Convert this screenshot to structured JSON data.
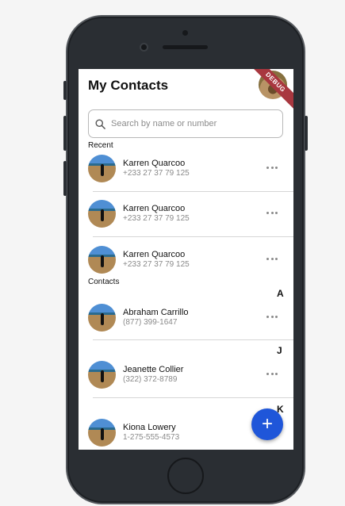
{
  "header": {
    "title": "My Contacts",
    "debug_banner": "DEBUG"
  },
  "search": {
    "placeholder": "Search by name or number",
    "value": ""
  },
  "sections": {
    "recent": "Recent",
    "contacts": "Contacts"
  },
  "recent": [
    {
      "name": "Karren Quarcoo",
      "phone": "+233 27 37 79 125"
    },
    {
      "name": "Karren Quarcoo",
      "phone": "+233 27 37 79 125"
    },
    {
      "name": "Karren Quarcoo",
      "phone": "+233 27 37 79 125"
    }
  ],
  "letters": {
    "a": "A",
    "j": "J",
    "k": "K"
  },
  "contacts": [
    {
      "name": "Abraham Carrillo",
      "phone": "(877) 399-1647"
    },
    {
      "name": "Jeanette Collier",
      "phone": "(322) 372-8789"
    },
    {
      "name": "Kiona Lowery",
      "phone": "1-275-555-4573"
    }
  ],
  "fab": {
    "label": "+"
  },
  "colors": {
    "accent": "#1f56d9",
    "debug": "#a8373f"
  }
}
